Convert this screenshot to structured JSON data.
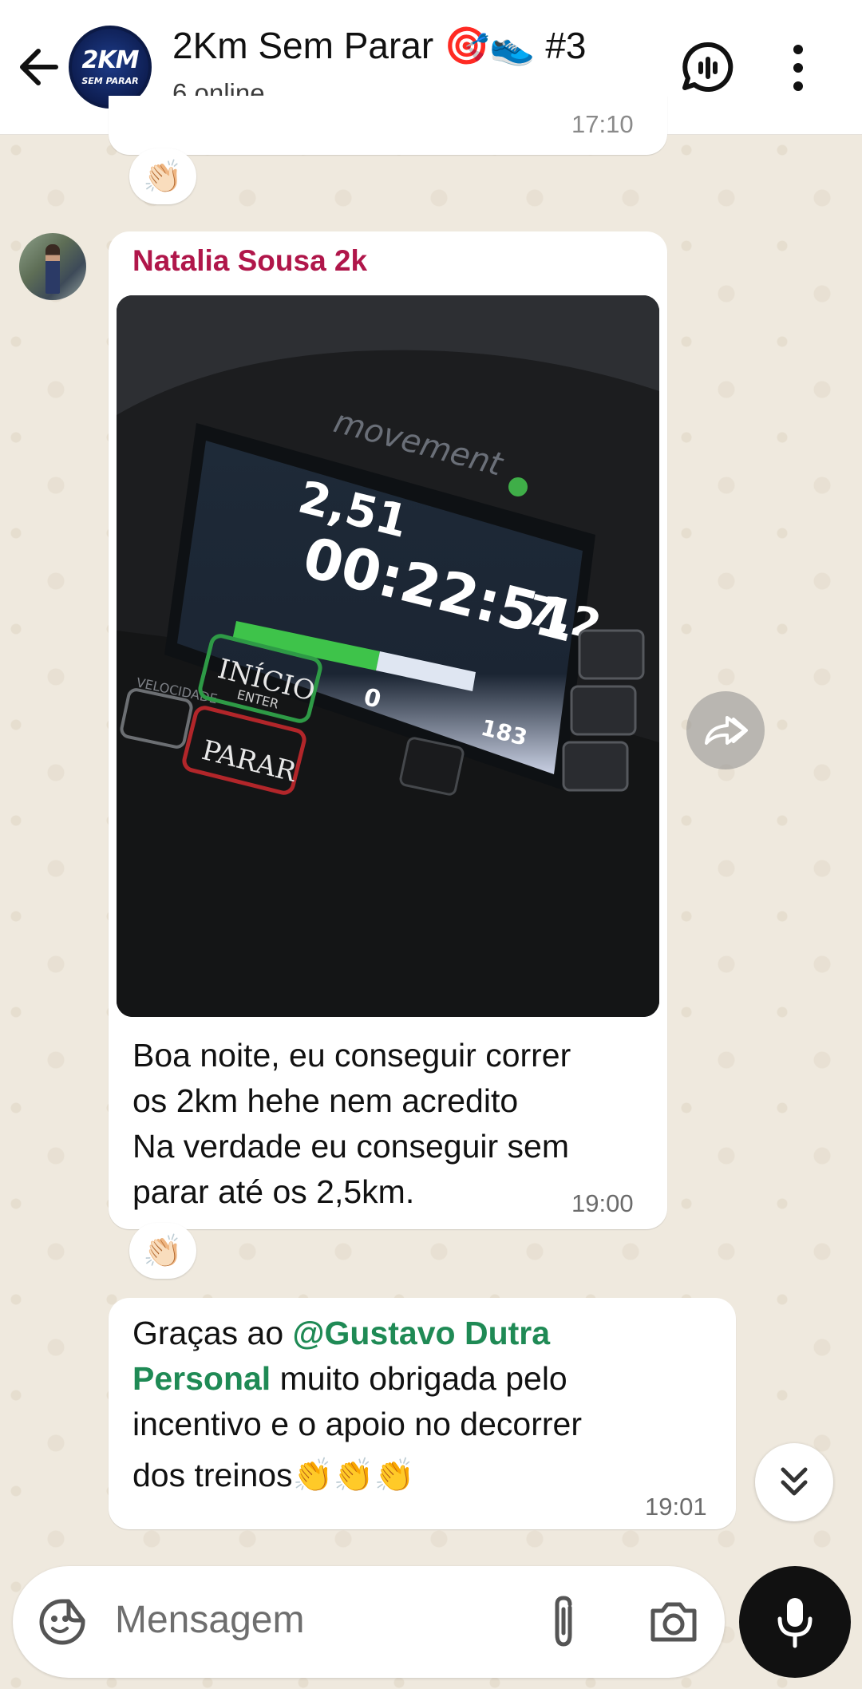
{
  "header": {
    "title": "2Km Sem Parar 🎯👟 #3",
    "subtitle": "6 online",
    "avatar_text_big": "2KM",
    "avatar_text_small": "SEM PARAR"
  },
  "messages": [
    {
      "sender": "Natalia Sousa 2k",
      "photo_display": {
        "distance": "2,51",
        "time": "00:22:51",
        "speed": "7,2",
        "zero": "0",
        "calories": "183",
        "brand": "movement",
        "label_velocidade": "VELOCIDADE",
        "btn_start": "INÍCIO",
        "btn_start_sub": "ENTER",
        "btn_stop": "PARAR"
      },
      "text_lines": [
        "Boa noite, eu conseguir correr",
        "os 2km hehe nem acredito",
        "Na verdade eu conseguir sem",
        "parar até os 2,5km."
      ],
      "time": "19:00",
      "reaction": "👏🏻"
    },
    {
      "text_before": "Graças ao ",
      "mention_line1": "@Gustavo Dutra",
      "mention_line2": "Personal",
      "text_after_line2": " muito obrigada pelo",
      "line3": "incentivo e o apoio no decorrer",
      "line4": "dos treinos👏👏👏",
      "time": "19:01"
    }
  ],
  "previous": {
    "time": "17:10",
    "reaction": "👏🏻"
  },
  "composer": {
    "placeholder": "Mensagem"
  },
  "colors": {
    "sender": "#b0164a",
    "mention": "#1f8a55",
    "bubble": "#ffffff",
    "background": "#efe9de"
  }
}
